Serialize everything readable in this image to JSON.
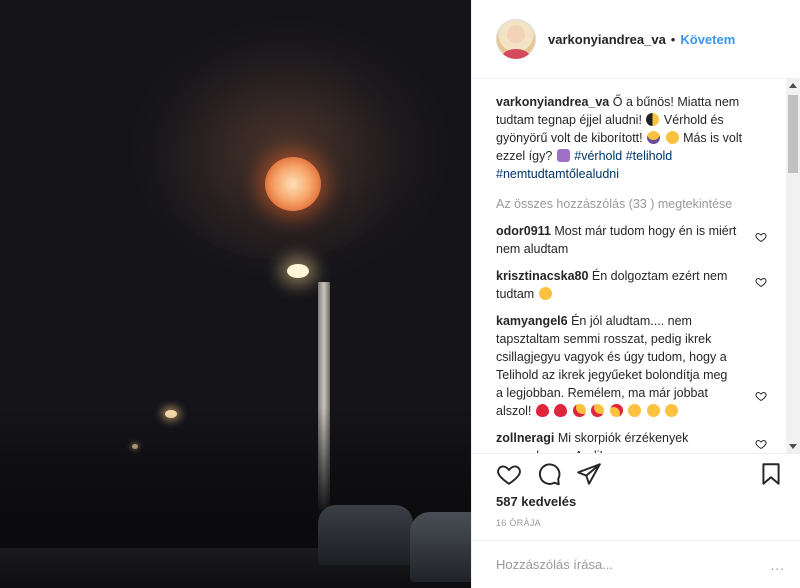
{
  "post": {
    "username": "varkonyiandrea_va",
    "separator": "•",
    "follow_label": "Követem"
  },
  "caption": {
    "username": "varkonyiandrea_va",
    "text_part1": "Ő a bűnös! Miatta nem tudtam tegnap éjjel aludni!",
    "text_part2": "Vérhold és gyönyörű volt de kiborított!",
    "text_part3": "Más is volt ezzel így?",
    "hashtags": [
      "#vérhold",
      "#telihold",
      "#nemtudtamtőlealudni"
    ]
  },
  "view_all_comments": "Az összes hozzászólás (33 ) megtekintése",
  "comments": [
    {
      "user": "odor0911",
      "text": "Most már tudom hogy én is miért nem aludtam"
    },
    {
      "user": "krisztinacska80",
      "text": "Én dolgoztam ezért nem tudtam"
    },
    {
      "user": "kamyangel6",
      "text": "Én jól aludtam.... nem tapsztaltam semmi rosszat, pedig ikrek csillagjegyu vagyok és úgy tudom, hogy a Telihold az ikrek jegyűeket bolondítja meg a legjobban. Remélem, ma már jobbat alszol!"
    },
    {
      "user": "zollneragi",
      "text": "Mi skorpiók érzékenyek vagyunk arra. Andi!"
    }
  ],
  "likes": "587 kedvelés",
  "timestamp": "16 ÓRÁJA",
  "add_comment_placeholder": "Hozzászólás írása...",
  "more_symbol": "...",
  "icons": [
    "heart-icon",
    "comment-icon",
    "share-icon",
    "bookmark-icon"
  ],
  "colors": {
    "link": "#3897f0",
    "hashtag": "#003569",
    "muted": "#999999",
    "heart_red": "#ed4956"
  }
}
